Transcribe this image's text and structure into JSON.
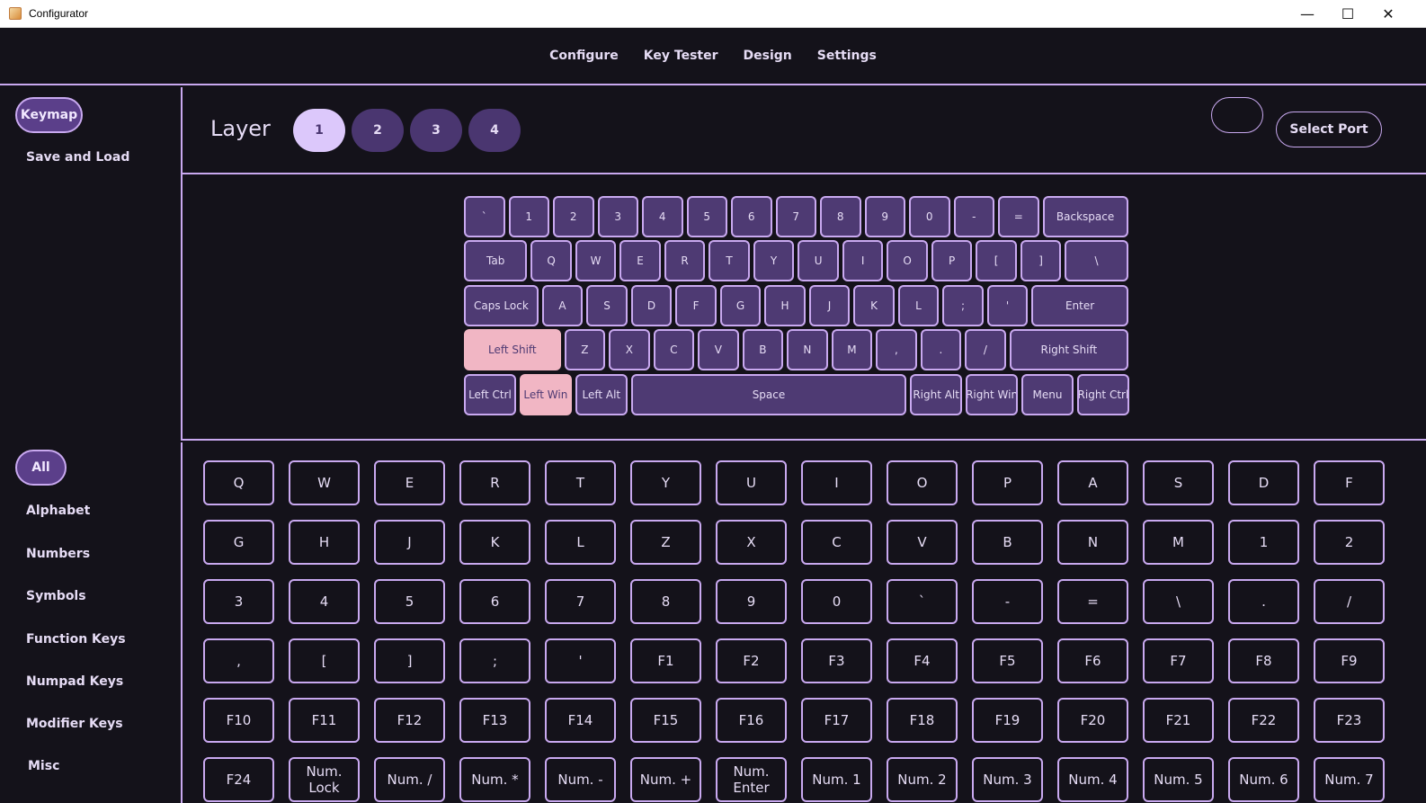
{
  "window": {
    "title": "Configurator",
    "controls": {
      "minimize": "—",
      "maximize": "☐",
      "close": "✕"
    }
  },
  "nav": {
    "tabs": [
      "Configure",
      "Key Tester",
      "Design",
      "Settings"
    ]
  },
  "sidebar": {
    "top": [
      "Keymap",
      "Save and Load"
    ],
    "active_top": "Keymap",
    "categories": [
      "All",
      "Alphabet",
      "Numbers",
      "Symbols",
      "Function Keys",
      "Numpad Keys",
      "Modifier Keys",
      "Misc"
    ],
    "active_category": "All"
  },
  "layers": {
    "label": "Layer",
    "buttons": [
      "1",
      "2",
      "3",
      "4"
    ],
    "active": "1"
  },
  "port": {
    "select_label": "Select Port"
  },
  "keyboard": {
    "rows": [
      [
        [
          "`",
          1
        ],
        [
          "1",
          1
        ],
        [
          "2",
          1
        ],
        [
          "3",
          1
        ],
        [
          "4",
          1
        ],
        [
          "5",
          1
        ],
        [
          "6",
          1
        ],
        [
          "7",
          1
        ],
        [
          "8",
          1
        ],
        [
          "9",
          1
        ],
        [
          "0",
          1
        ],
        [
          "-",
          1
        ],
        [
          "=",
          1
        ],
        [
          "Backspace",
          2
        ]
      ],
      [
        [
          "Tab",
          1.5
        ],
        [
          "Q",
          1
        ],
        [
          "W",
          1
        ],
        [
          "E",
          1
        ],
        [
          "R",
          1
        ],
        [
          "T",
          1
        ],
        [
          "Y",
          1
        ],
        [
          "U",
          1
        ],
        [
          "I",
          1
        ],
        [
          "O",
          1
        ],
        [
          "P",
          1
        ],
        [
          "[",
          1
        ],
        [
          "]",
          1
        ],
        [
          "\\",
          1.5
        ]
      ],
      [
        [
          "Caps Lock",
          1.75
        ],
        [
          "A",
          1
        ],
        [
          "S",
          1
        ],
        [
          "D",
          1
        ],
        [
          "F",
          1
        ],
        [
          "G",
          1
        ],
        [
          "H",
          1
        ],
        [
          "J",
          1
        ],
        [
          "K",
          1
        ],
        [
          "L",
          1
        ],
        [
          ";",
          1
        ],
        [
          "'",
          1
        ],
        [
          "Enter",
          2.25
        ]
      ],
      [
        [
          "Left Shift",
          2.25
        ],
        [
          "Z",
          1
        ],
        [
          "X",
          1
        ],
        [
          "C",
          1
        ],
        [
          "V",
          1
        ],
        [
          "B",
          1
        ],
        [
          "N",
          1
        ],
        [
          "M",
          1
        ],
        [
          ",",
          1
        ],
        [
          ".",
          1
        ],
        [
          "/",
          1
        ],
        [
          "Right Shift",
          2.75
        ]
      ],
      [
        [
          "Left Ctrl",
          1.25
        ],
        [
          "Left Win",
          1.25
        ],
        [
          "Left Alt",
          1.25
        ],
        [
          "Space",
          6.25
        ],
        [
          "Right Alt",
          1.25
        ],
        [
          "Right Win",
          1.25
        ],
        [
          "Menu",
          1.25
        ],
        [
          "Right Ctrl",
          1.25
        ]
      ]
    ],
    "highlighted": [
      "Left Shift",
      "Left Win"
    ]
  },
  "palette": {
    "keys": [
      "Q",
      "W",
      "E",
      "R",
      "T",
      "Y",
      "U",
      "I",
      "O",
      "P",
      "A",
      "S",
      "D",
      "F",
      "G",
      "H",
      "J",
      "K",
      "L",
      "Z",
      "X",
      "C",
      "V",
      "B",
      "N",
      "M",
      "1",
      "2",
      "3",
      "4",
      "5",
      "6",
      "7",
      "8",
      "9",
      "0",
      "`",
      "-",
      "=",
      "\\",
      ".",
      "/",
      ",",
      "[",
      "]",
      ";",
      "'",
      "F1",
      "F2",
      "F3",
      "F4",
      "F5",
      "F6",
      "F7",
      "F8",
      "F9",
      "F10",
      "F11",
      "F12",
      "F13",
      "F14",
      "F15",
      "F16",
      "F17",
      "F18",
      "F19",
      "F20",
      "F21",
      "F22",
      "F23",
      "F24",
      "Num. Lock",
      "Num. /",
      "Num. *",
      "Num. -",
      "Num. +",
      "Num.\nEnter",
      "Num. 1",
      "Num. 2",
      "Num. 3",
      "Num. 4",
      "Num. 5",
      "Num. 6",
      "Num. 7"
    ]
  }
}
